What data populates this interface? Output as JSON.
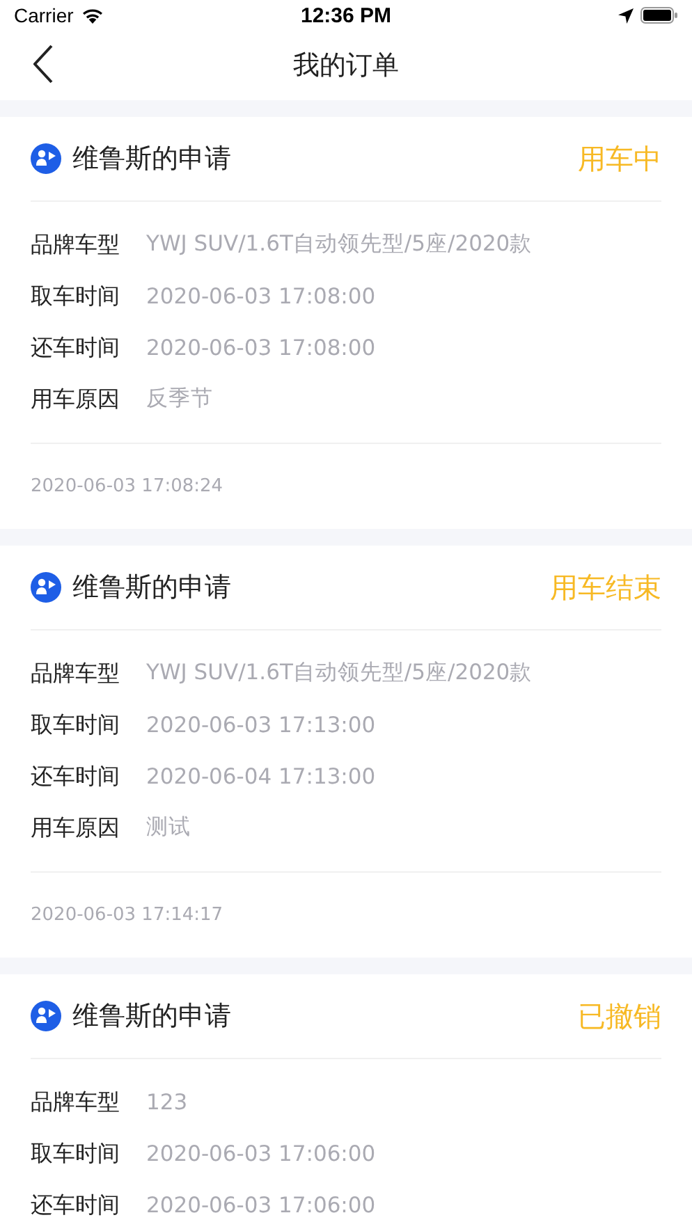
{
  "status_bar": {
    "carrier": "Carrier",
    "time": "12:36 PM"
  },
  "nav": {
    "title": "我的订单"
  },
  "orders": [
    {
      "applicant": "维鲁斯的申请",
      "status": "用车中",
      "fields": [
        {
          "label": "品牌车型",
          "value": "YWJ SUV/1.6T自动领先型/5座/2020款"
        },
        {
          "label": "取车时间",
          "value": "2020-06-03 17:08:00"
        },
        {
          "label": "还车时间",
          "value": "2020-06-03 17:08:00"
        },
        {
          "label": "用车原因",
          "value": "反季节"
        }
      ],
      "created": "2020-06-03 17:08:24"
    },
    {
      "applicant": "维鲁斯的申请",
      "status": "用车结束",
      "fields": [
        {
          "label": "品牌车型",
          "value": "YWJ SUV/1.6T自动领先型/5座/2020款"
        },
        {
          "label": "取车时间",
          "value": "2020-06-03 17:13:00"
        },
        {
          "label": "还车时间",
          "value": "2020-06-04 17:13:00"
        },
        {
          "label": "用车原因",
          "value": "测试"
        }
      ],
      "created": "2020-06-03 17:14:17"
    },
    {
      "applicant": "维鲁斯的申请",
      "status": "已撤销",
      "fields": [
        {
          "label": "品牌车型",
          "value": "123"
        },
        {
          "label": "取车时间",
          "value": "2020-06-03 17:06:00"
        },
        {
          "label": "还车时间",
          "value": "2020-06-03 17:06:00"
        }
      ]
    }
  ]
}
